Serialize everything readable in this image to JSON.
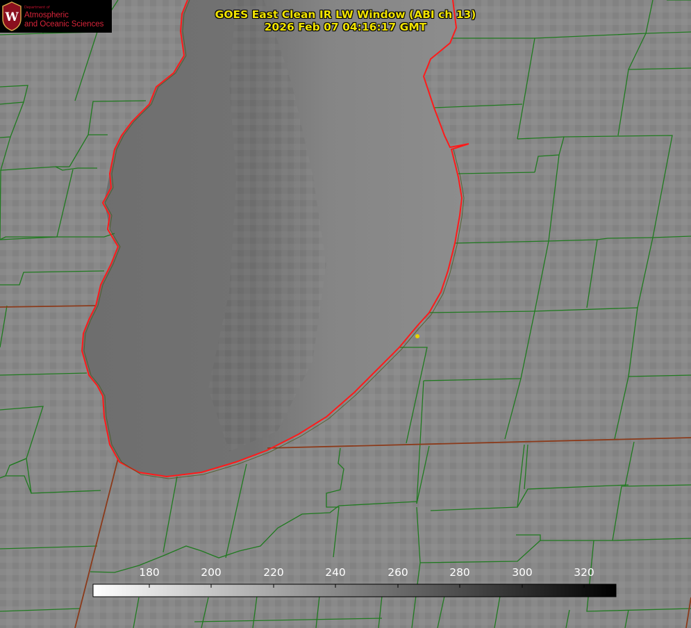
{
  "logo": {
    "department": "Department of",
    "line1": "Atmospheric",
    "line2": "and Oceanic Sciences",
    "crest_letter": "W",
    "accent_color": "#c8102e"
  },
  "title": {
    "line1": "GOES East Clean IR LW Window (ABI ch 13)",
    "line2": "2026 Feb 07 04:16:17 GMT",
    "color": "#f2e400"
  },
  "colorbar": {
    "min": 150,
    "max": 330,
    "ticks": [
      "180",
      "200",
      "220",
      "240",
      "260",
      "280",
      "300",
      "320"
    ],
    "scale": "white-to-black grayscale (brightness temperature)"
  },
  "map": {
    "county_line_color": "#1f7a1f",
    "coastline_color": "#ff1a1a",
    "state_line_color": "#8b3a1a",
    "marker_color": "#e6d200"
  }
}
